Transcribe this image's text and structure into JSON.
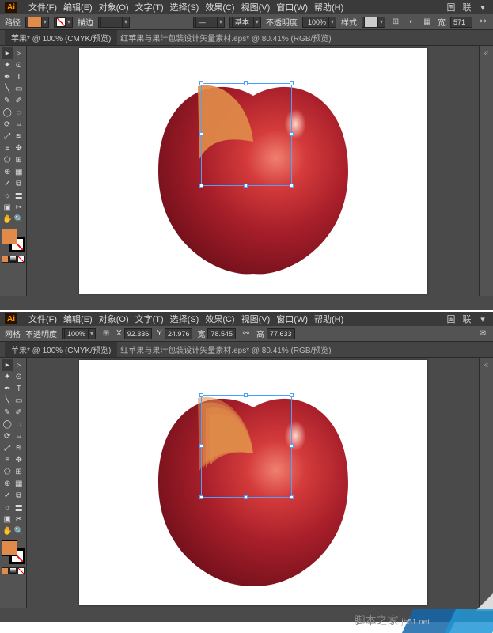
{
  "app_logo": "Ai",
  "menus": {
    "file": "文件(F)",
    "edit": "编辑(E)",
    "object": "对象(O)",
    "type": "文字(T)",
    "select": "选择(S)",
    "effect": "效果(C)",
    "view": "视图(V)",
    "window": "窗口(W)",
    "help": "帮助(H)"
  },
  "title_icons": {
    "layout": "国",
    "arrange": "联"
  },
  "options1": {
    "label": "路径",
    "stroke_label": "描边",
    "stroke_value": "",
    "basic_label": "基本",
    "opacity_label": "不透明度",
    "opacity_value": "100%",
    "style_label": "样式",
    "w_label": "宽",
    "w_value": "571",
    "link_label": "链"
  },
  "options2": {
    "label": "网格",
    "opacity_label": "不透明度",
    "opacity_value": "100%",
    "coord_x_label": "X",
    "coord_x_value": "92.336",
    "coord_y_label": "Y",
    "coord_y_value": "24.976",
    "w_label": "宽",
    "w_value": "78.545",
    "h_label": "高",
    "h_value": "77.633"
  },
  "doc": {
    "tab": "苹果* @ 100% (CMYK/预览)",
    "filename": "红苹果与果汁包装设计矢量素材.eps* @ 80.41% (RGB/预览)"
  },
  "watermark": "脚本之家",
  "watermark_url": "jb51.net",
  "fill_color": "#e08b4a",
  "tool_glyphs": {
    "selection": "▸",
    "direct": "▹",
    "wand": "✦",
    "lasso": "⊙",
    "pen": "✒",
    "type": "T",
    "line": "╲",
    "rect": "▭",
    "brush": "✎",
    "pencil": "✐",
    "blob": "◯",
    "eraser": "◌",
    "rotate": "⟳",
    "reflect": "⇔",
    "scale": "⤢",
    "warp": "≋",
    "width": "≡",
    "free": "✥",
    "shape": "⬠",
    "perspective": "⊞",
    "mesh": "⊕",
    "gradient": "▦",
    "eyedrop": "✓",
    "blend": "⧉",
    "symbol": "☼",
    "graph": "〓",
    "artboard": "▣",
    "slice": "✂",
    "hand": "✋",
    "zoom": "🔍"
  }
}
